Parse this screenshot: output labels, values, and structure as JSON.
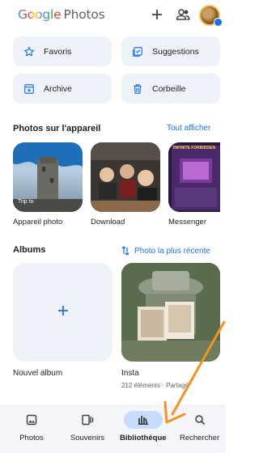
{
  "header": {
    "logo_google": "Google",
    "logo_photos": "Photos",
    "add_icon": "plus-icon",
    "share_icon": "people-icon",
    "avatar_icon": "avatar"
  },
  "quick_actions": [
    {
      "label": "Favoris",
      "icon": "star-icon"
    },
    {
      "label": "Suggestions",
      "icon": "suggestions-icon"
    },
    {
      "label": "Archive",
      "icon": "archive-icon"
    },
    {
      "label": "Corbeille",
      "icon": "trash-icon"
    }
  ],
  "device_section": {
    "title": "Photos sur l'appareil",
    "link": "Tout afficher",
    "folders": [
      {
        "label": "Appareil photo",
        "overlay": "Trip to"
      },
      {
        "label": "Download"
      },
      {
        "label": "Messenger",
        "overlay": "INFINITE FORBIDDEN"
      }
    ]
  },
  "albums_section": {
    "title": "Albums",
    "link": "Photo la plus récente",
    "new_album_label": "Nouvel album",
    "insta_label": "Insta",
    "insta_sub": "212 éléments · Partagé"
  },
  "bottom_nav": [
    {
      "label": "Photos",
      "icon": "photo-icon",
      "active": false
    },
    {
      "label": "Souvenirs",
      "icon": "memories-icon",
      "active": false
    },
    {
      "label": "Bibliothèque",
      "icon": "library-icon",
      "active": true
    },
    {
      "label": "Rechercher",
      "icon": "search-icon",
      "active": false
    }
  ],
  "colors": {
    "accent": "#1a73e8",
    "chip_bg": "#eef2f9",
    "nav_active": "#c6dcfa",
    "annotation_arrow": "#f5921e"
  }
}
